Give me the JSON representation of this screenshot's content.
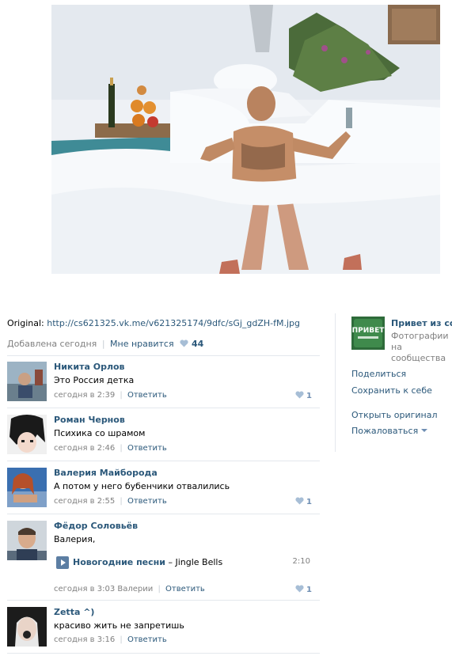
{
  "original": {
    "label": "Original:",
    "url": "http://cs621325.vk.me/v621325174/9dfc/sGj_gdZH-fM.jpg"
  },
  "meta": {
    "added": "Добавлена сегодня",
    "like_label": "Мне нравится",
    "likes": "44"
  },
  "comments": [
    {
      "author": "Никита Орлов",
      "text": "Это Россия детка",
      "time": "сегодня в 2:39",
      "reply": "Ответить",
      "likes": "1"
    },
    {
      "author": "Роман Чернов",
      "text": "Психика со шрамом",
      "time": "сегодня в 2:46",
      "reply": "Ответить",
      "likes": ""
    },
    {
      "author": "Валерия Майборода",
      "text": "А потом у него бубенчики отвалились",
      "time": "сегодня в 2:55",
      "reply": "Ответить",
      "likes": "1"
    },
    {
      "author": "Фёдор Соловьёв",
      "text": "Валерия,",
      "time": "сегодня в 3:03 Валерии",
      "reply": "Ответить",
      "likes": "1",
      "audio": {
        "artist": "Новогодние песни",
        "dash": " – ",
        "title": "Jingle Bells",
        "duration": "2:10"
      }
    },
    {
      "author": "Zetta ^)",
      "text": "красиво жить не запретишь",
      "time": "сегодня в 3:16",
      "reply": "Ответить",
      "likes": ""
    }
  ],
  "group": {
    "name": "Привет из соц",
    "subtitle": "Фотографии на сообщества",
    "logo_text": "ПРИВЕТ"
  },
  "actions": {
    "share": "Поделиться",
    "save": "Сохранить к себе",
    "open_original": "Открыть оригинал",
    "report": "Пожаловаться"
  },
  "colors": {
    "link": "#2b587a",
    "gray": "#808080",
    "divider": "#e4e8ed",
    "like": "#6e8eb3"
  },
  "icons": {
    "like": "heart-icon",
    "play": "play-icon",
    "dropdown": "caret-down-icon"
  }
}
